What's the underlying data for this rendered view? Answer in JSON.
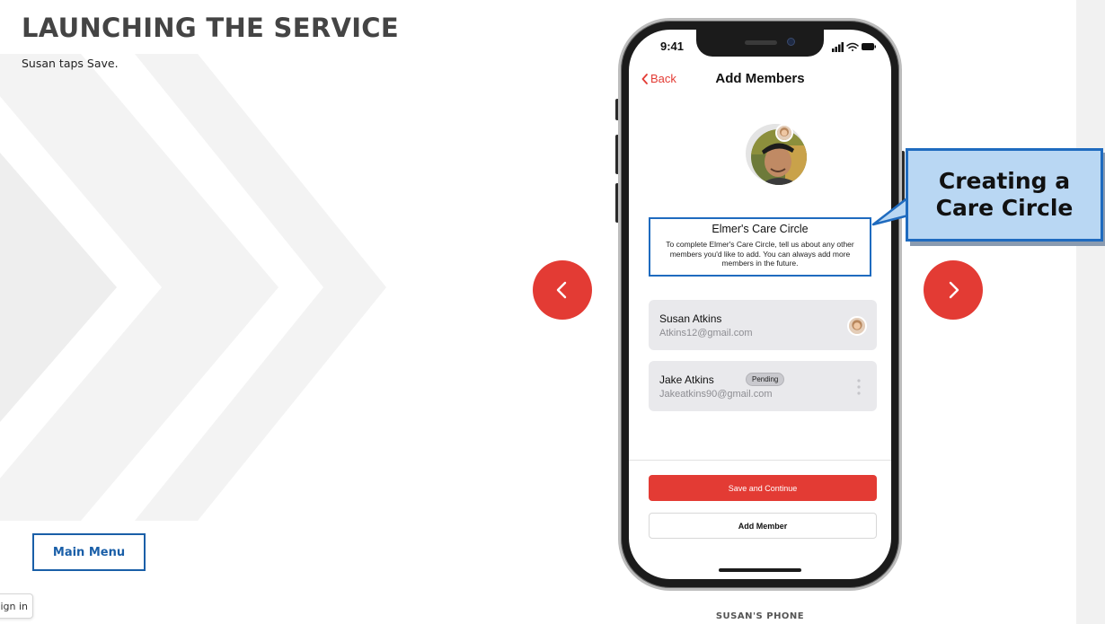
{
  "page": {
    "title": "LAUNCHING THE SERVICE",
    "subtitle": "Susan taps Save.",
    "main_menu_label": "Main Menu",
    "signin_label": "Sign in",
    "phone_caption": "SUSAN'S PHONE"
  },
  "phone": {
    "status_time": "9:41",
    "back_label": "Back",
    "screen_title": "Add Members",
    "circle_name": "Elmer's Care Circle",
    "circle_description": "To complete Elmer's Care Circle, tell us about any other members you'd like to add. You can always add more members in the future.",
    "members": [
      {
        "name": "Susan Atkins",
        "email": "Atkins12@gmail.com",
        "badge": ""
      },
      {
        "name": "Jake Atkins",
        "email": "Jakeatkins90@gmail.com",
        "badge": "Pending"
      }
    ],
    "save_label": "Save and Continue",
    "add_member_label": "Add Member"
  },
  "callout": {
    "line1": "Creating a",
    "line2": "Care Circle"
  },
  "colors": {
    "accent_red": "#e33b34",
    "brand_blue": "#1f6bbf",
    "callout_fill": "#b9d7f3",
    "title_gray": "#444444"
  },
  "icons": [
    "chevron-left-icon",
    "chevron-right-icon",
    "back-chevron-icon",
    "signal-icon",
    "wifi-icon",
    "battery-icon",
    "more-vertical-icon"
  ]
}
